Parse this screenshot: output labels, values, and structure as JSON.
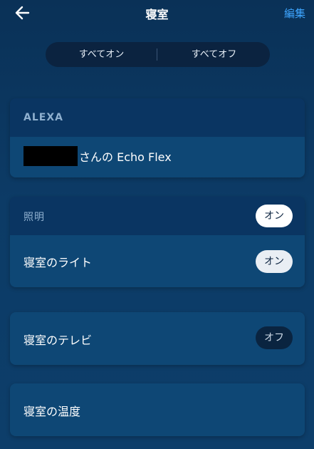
{
  "header": {
    "back_icon": "arrow-left-icon",
    "title": "寝室",
    "edit_label": "編集"
  },
  "segmented": {
    "all_on_label": "すべてオン",
    "all_off_label": "すべてオフ"
  },
  "alexa_card": {
    "section_label": "ALEXA",
    "device_suffix": "さんの Echo Flex"
  },
  "lighting_card": {
    "section_label": "照明",
    "group_toggle_label": "オン",
    "device_name": "寝室のライト",
    "device_toggle_label": "オン"
  },
  "tv_card": {
    "device_name": "寝室のテレビ",
    "toggle_label": "オフ"
  },
  "temp_card": {
    "device_name": "寝室の温度"
  },
  "colors": {
    "accent": "#3ea6ff",
    "background": "#0c3b66",
    "card": "#0a3562",
    "row": "#0e4775"
  }
}
